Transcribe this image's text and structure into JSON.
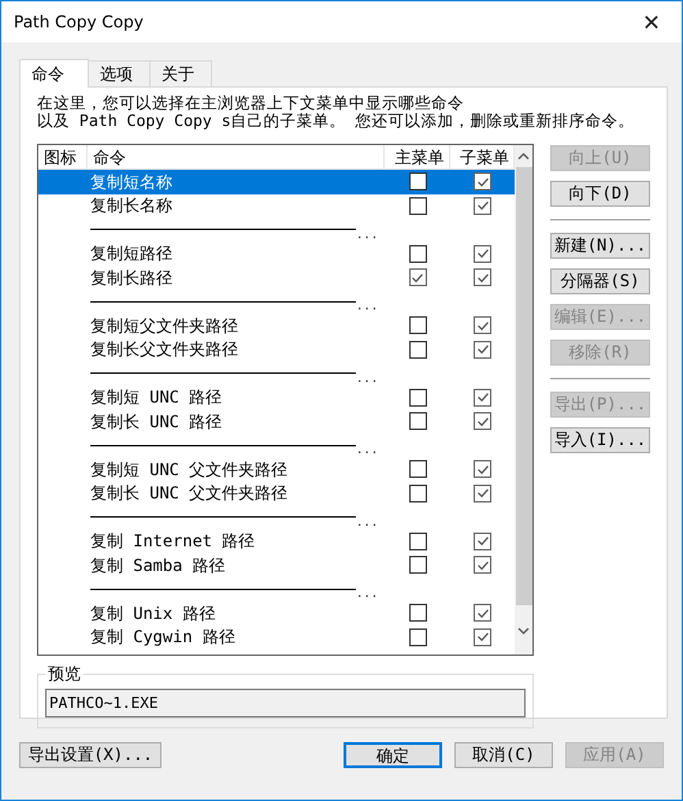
{
  "window": {
    "title": "Path Copy Copy",
    "close": "✕"
  },
  "tabs": [
    {
      "label": "命令",
      "selected": true
    },
    {
      "label": "选项",
      "selected": false
    },
    {
      "label": "关于",
      "selected": false
    }
  ],
  "description": [
    "在这里，您可以选择在主浏览器上下文菜单中显示哪些命令",
    "以及 Path Copy Copy s自己的子菜单。 您还可以添加，删除或重新排序命令。"
  ],
  "table": {
    "columns": [
      "图标",
      "命令",
      "主菜单",
      "子菜单"
    ],
    "rows": [
      {
        "kind": "command",
        "label": "复制短名称",
        "main": false,
        "sub": true,
        "selected": true
      },
      {
        "kind": "command",
        "label": "复制长名称",
        "main": false,
        "sub": true,
        "selected": false
      },
      {
        "kind": "separator",
        "label": "...",
        "selected": false
      },
      {
        "kind": "command",
        "label": "复制短路径",
        "main": false,
        "sub": true,
        "selected": false
      },
      {
        "kind": "command",
        "label": "复制长路径",
        "main": true,
        "sub": true,
        "selected": false
      },
      {
        "kind": "separator",
        "label": "...",
        "selected": false
      },
      {
        "kind": "command",
        "label": "复制短父文件夹路径",
        "main": false,
        "sub": true,
        "selected": false
      },
      {
        "kind": "command",
        "label": "复制长父文件夹路径",
        "main": false,
        "sub": true,
        "selected": false
      },
      {
        "kind": "separator",
        "label": "...",
        "selected": false
      },
      {
        "kind": "command",
        "label": "复制短 UNC 路径",
        "main": false,
        "sub": true,
        "selected": false
      },
      {
        "kind": "command",
        "label": "复制长 UNC 路径",
        "main": false,
        "sub": true,
        "selected": false
      },
      {
        "kind": "separator",
        "label": "...",
        "selected": false
      },
      {
        "kind": "command",
        "label": "复制短 UNC 父文件夹路径",
        "main": false,
        "sub": true,
        "selected": false
      },
      {
        "kind": "command",
        "label": "复制长 UNC 父文件夹路径",
        "main": false,
        "sub": true,
        "selected": false
      },
      {
        "kind": "separator",
        "label": "...",
        "selected": false
      },
      {
        "kind": "command",
        "label": "复制 Internet 路径",
        "main": false,
        "sub": true,
        "selected": false
      },
      {
        "kind": "command",
        "label": "复制 Samba 路径",
        "main": false,
        "sub": true,
        "selected": false
      },
      {
        "kind": "separator",
        "label": "...",
        "selected": false
      },
      {
        "kind": "command",
        "label": "复制 Unix 路径",
        "main": false,
        "sub": true,
        "selected": false
      },
      {
        "kind": "command",
        "label": "复制 Cygwin 路径",
        "main": false,
        "sub": true,
        "selected": false
      }
    ]
  },
  "side_buttons": [
    {
      "label": "向上(U)",
      "disabled": true
    },
    {
      "label": "向下(D)",
      "disabled": false
    },
    {
      "kind": "divider"
    },
    {
      "label": "新建(N)...",
      "disabled": false
    },
    {
      "label": "分隔器(S)",
      "disabled": false
    },
    {
      "label": "编辑(E)...",
      "disabled": true
    },
    {
      "label": "移除(R)",
      "disabled": true
    },
    {
      "kind": "divider"
    },
    {
      "label": "导出(P)...",
      "disabled": true
    },
    {
      "label": "导入(I)...",
      "disabled": false
    }
  ],
  "preview": {
    "label": "预览",
    "value": "PATHCO~1.EXE"
  },
  "footer_buttons": [
    {
      "label": "导出设置(X)...",
      "disabled": false,
      "default": false
    },
    {
      "label": "确定",
      "disabled": false,
      "default": true
    },
    {
      "label": "取消(C)",
      "disabled": false,
      "default": false
    },
    {
      "label": "应用(A)",
      "disabled": true,
      "default": false
    }
  ]
}
